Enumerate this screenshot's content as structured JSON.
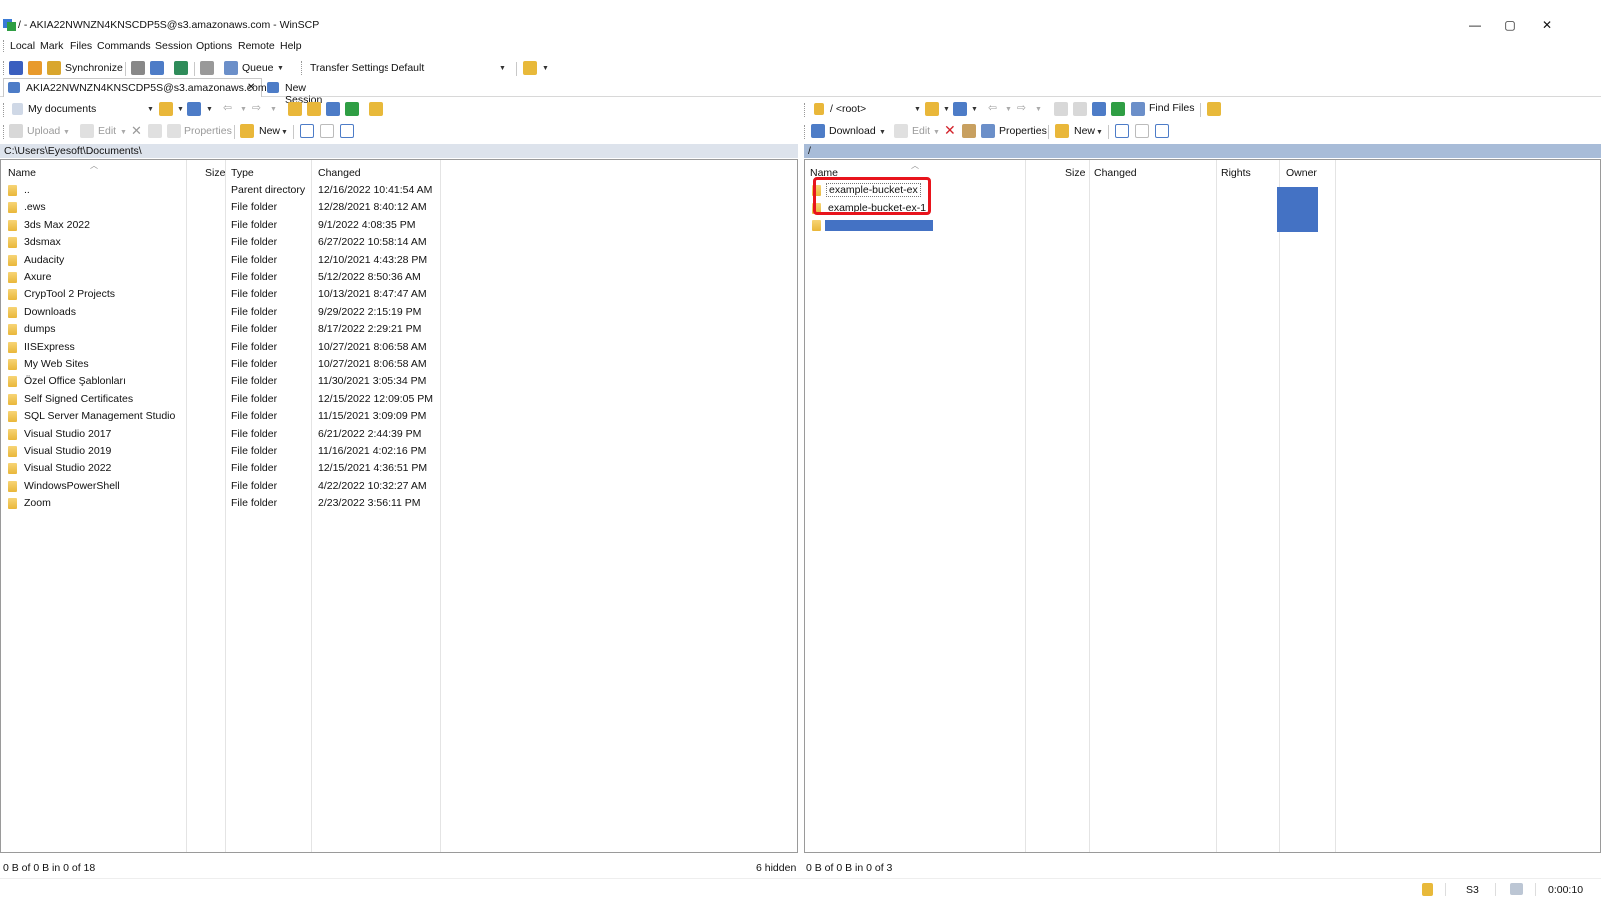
{
  "window": {
    "title": "/ - AKIA22NWNZN4KNSCDP5S@s3.amazonaws.com - WinSCP",
    "minimize": "—",
    "maximize": "▢",
    "close": "✕"
  },
  "menu": [
    "Local",
    "Mark",
    "Files",
    "Commands",
    "Session",
    "Options",
    "Remote",
    "Help"
  ],
  "toolbar": {
    "synchronize": "Synchronize",
    "queue": "Queue",
    "transfer_settings_label": "Transfer Settings",
    "transfer_settings_value": "Default"
  },
  "tabs": {
    "active": "AKIA22NWNZN4KNSCDP5S@s3.amazonaws.com",
    "close": "✕",
    "new_session": "New Session"
  },
  "local": {
    "location": "My documents",
    "path": "C:\\Users\\Eyesoft\\Documents\\",
    "actions": {
      "upload": "Upload",
      "edit": "Edit",
      "properties": "Properties",
      "new": "New"
    },
    "columns": [
      "Name",
      "Size",
      "Type",
      "Changed"
    ],
    "rows": [
      {
        "name": "..",
        "type": "Parent directory",
        "changed": "12/16/2022 10:41:54 AM"
      },
      {
        "name": ".ews",
        "type": "File folder",
        "changed": "12/28/2021 8:40:12 AM"
      },
      {
        "name": "3ds Max 2022",
        "type": "File folder",
        "changed": "9/1/2022 4:08:35 PM"
      },
      {
        "name": "3dsmax",
        "type": "File folder",
        "changed": "6/27/2022 10:58:14 AM"
      },
      {
        "name": "Audacity",
        "type": "File folder",
        "changed": "12/10/2021 4:43:28 PM"
      },
      {
        "name": "Axure",
        "type": "File folder",
        "changed": "5/12/2022 8:50:36 AM"
      },
      {
        "name": "CrypTool 2 Projects",
        "type": "File folder",
        "changed": "10/13/2021 8:47:47 AM"
      },
      {
        "name": "Downloads",
        "type": "File folder",
        "changed": "9/29/2022 2:15:19 PM"
      },
      {
        "name": "dumps",
        "type": "File folder",
        "changed": "8/17/2022 2:29:21 PM"
      },
      {
        "name": "IISExpress",
        "type": "File folder",
        "changed": "10/27/2021 8:06:58 AM"
      },
      {
        "name": "My Web Sites",
        "type": "File folder",
        "changed": "10/27/2021 8:06:58 AM"
      },
      {
        "name": "Özel Office Şablonları",
        "type": "File folder",
        "changed": "11/30/2021 3:05:34 PM"
      },
      {
        "name": "Self Signed Certificates",
        "type": "File folder",
        "changed": "12/15/2022 12:09:05 PM"
      },
      {
        "name": "SQL Server Management Studio",
        "type": "File folder",
        "changed": "11/15/2021 3:09:09 PM"
      },
      {
        "name": "Visual Studio 2017",
        "type": "File folder",
        "changed": "6/21/2022 2:44:39 PM"
      },
      {
        "name": "Visual Studio 2019",
        "type": "File folder",
        "changed": "11/16/2021 4:02:16 PM"
      },
      {
        "name": "Visual Studio 2022",
        "type": "File folder",
        "changed": "12/15/2021 4:36:51 PM"
      },
      {
        "name": "WindowsPowerShell",
        "type": "File folder",
        "changed": "4/22/2022 10:32:27 AM"
      },
      {
        "name": "Zoom",
        "type": "File folder",
        "changed": "2/23/2022 3:56:11 PM"
      }
    ],
    "status_left": "0 B of 0 B in 0 of 18",
    "status_right": "6 hidden"
  },
  "remote": {
    "location": "/ <root>",
    "path": "/",
    "actions": {
      "download": "Download",
      "edit": "Edit",
      "properties": "Properties",
      "new": "New",
      "find_files": "Find Files"
    },
    "columns": [
      "Name",
      "Size",
      "Changed",
      "Rights",
      "Owner"
    ],
    "rows": [
      {
        "name": "example-bucket-ex"
      },
      {
        "name": "example-bucket-ex-1"
      }
    ],
    "status_left": "0 B of 0 B in 0 of 3"
  },
  "statusbar": {
    "protocol": "S3",
    "elapsed": "0:00:10"
  },
  "colors": {
    "highlight_box": "#e8141c",
    "selection": "#4472c4",
    "path_bar_local": "#dde3ec",
    "path_bar_remote": "#a8bcd8"
  }
}
